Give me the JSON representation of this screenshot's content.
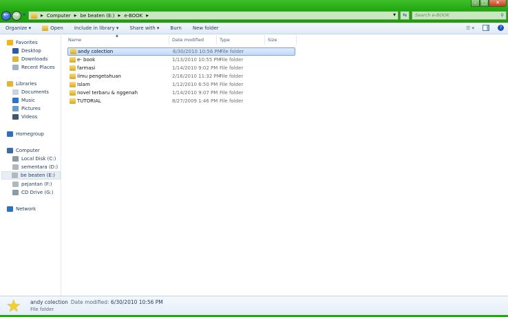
{
  "address": {
    "crumbs": [
      "Computer",
      "be beaten (E:)",
      "e-BOOK"
    ]
  },
  "search": {
    "placeholder": "Search e-BOOK"
  },
  "toolbar": {
    "organize": "Organize ▾",
    "open": "Open",
    "include": "Include in library ▾",
    "share": "Share with ▾",
    "burn": "Burn",
    "new_folder": "New folder"
  },
  "columns": {
    "name": "Name",
    "date": "Date modified",
    "type": "Type",
    "size": "Size"
  },
  "nav": {
    "favorites": "Favorites",
    "desktop": "Desktop",
    "downloads": "Downloads",
    "recent": "Recent Places",
    "libraries": "Libraries",
    "documents": "Documents",
    "music": "Music",
    "pictures": "Pictures",
    "videos": "Videos",
    "homegroup": "Homegroup",
    "computer": "Computer",
    "c": "Local Disk (C:)",
    "d": "sementara (D:)",
    "e": "be beaten (E:)",
    "f": "pejantan (F:)",
    "g": "CD Drive (G:)",
    "network": "Network"
  },
  "files": [
    {
      "name": "andy colection",
      "date": "6/30/2010 10:56 PM",
      "type": "File folder"
    },
    {
      "name": "e- book",
      "date": "1/13/2010 10:55 PM",
      "type": "File folder"
    },
    {
      "name": "farmasi",
      "date": "1/14/2010 9:02 PM",
      "type": "File folder"
    },
    {
      "name": "ilmu pengetahuan",
      "date": "2/16/2010 11:32 PM",
      "type": "File folder"
    },
    {
      "name": "Islam",
      "date": "1/12/2010 6:50 PM",
      "type": "File folder"
    },
    {
      "name": "novel terbaru & nggenah",
      "date": "1/14/2010 9:07 PM",
      "type": "File folder"
    },
    {
      "name": "TUTORIAL",
      "date": "8/27/2009 1:46 PM",
      "type": "File folder"
    }
  ],
  "status": {
    "name": "andy colection",
    "date_label": "Date modified:",
    "date": "6/30/2010 10:56 PM",
    "type": "File folder"
  },
  "colors": {
    "chrome": "#22a80f",
    "selection": "#c1dbfc",
    "text": "#1e395b"
  }
}
